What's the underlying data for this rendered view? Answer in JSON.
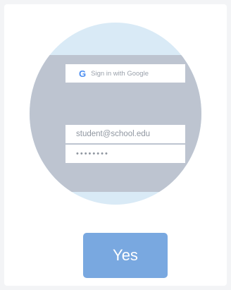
{
  "login_illustration": {
    "google_button_label": "Sign in with Google",
    "google_icon_glyph": "G",
    "email_value": "student@school.edu",
    "password_value": "••••••••"
  },
  "actions": {
    "yes_label": "Yes"
  },
  "colors": {
    "circle": "#d9eaf6",
    "panel": "#bdc4d0",
    "button": "#79a8e0",
    "google_blue": "#4a8df0"
  }
}
